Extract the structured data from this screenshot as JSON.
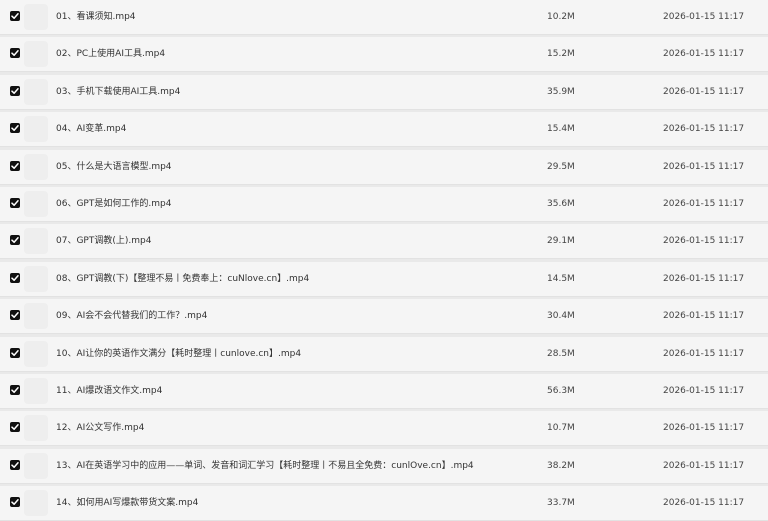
{
  "colors": {
    "background": "#e9e9e9",
    "row": "#f5f5f5",
    "checkbox": "#111111",
    "check": "#ffffff"
  },
  "icons": {
    "checkbox": "checkbox-checked-icon",
    "thumbnail": "video-thumbnail-icon"
  },
  "files": [
    {
      "name": "01、看课须知.mp4",
      "size": "10.2M",
      "modified": "2026-01-15 11:17",
      "checked": true
    },
    {
      "name": "02、PC上使用AI工具.mp4",
      "size": "15.2M",
      "modified": "2026-01-15 11:17",
      "checked": true
    },
    {
      "name": "03、手机下载使用AI工具.mp4",
      "size": "35.9M",
      "modified": "2026-01-15 11:17",
      "checked": true
    },
    {
      "name": "04、AI变革.mp4",
      "size": "15.4M",
      "modified": "2026-01-15 11:17",
      "checked": true
    },
    {
      "name": "05、什么是大语言模型.mp4",
      "size": "29.5M",
      "modified": "2026-01-15 11:17",
      "checked": true
    },
    {
      "name": "06、GPT是如何工作的.mp4",
      "size": "35.6M",
      "modified": "2026-01-15 11:17",
      "checked": true
    },
    {
      "name": "07、GPT调教(上).mp4",
      "size": "29.1M",
      "modified": "2026-01-15 11:17",
      "checked": true
    },
    {
      "name": "08、GPT调教(下)【整理不易丨免费奉上：cuNlove.cn】.mp4",
      "size": "14.5M",
      "modified": "2026-01-15 11:17",
      "checked": true
    },
    {
      "name": "09、AI会不会代替我们的工作？.mp4",
      "size": "30.4M",
      "modified": "2026-01-15 11:17",
      "checked": true
    },
    {
      "name": "10、AI让你的英语作文满分【耗时整理丨cunlove.cn】.mp4",
      "size": "28.5M",
      "modified": "2026-01-15 11:17",
      "checked": true
    },
    {
      "name": "11、AI爆改语文作文.mp4",
      "size": "56.3M",
      "modified": "2026-01-15 11:17",
      "checked": true
    },
    {
      "name": "12、AI公文写作.mp4",
      "size": "10.7M",
      "modified": "2026-01-15 11:17",
      "checked": true
    },
    {
      "name": "13、AI在英语学习中的应用——单词、发音和词汇学习【耗时整理丨不易且全免费：cunlOve.cn】.mp4",
      "size": "38.2M",
      "modified": "2026-01-15 11:17",
      "checked": true
    },
    {
      "name": "14、如何用AI写爆款带货文案.mp4",
      "size": "33.7M",
      "modified": "2026-01-15 11:17",
      "checked": true
    }
  ]
}
